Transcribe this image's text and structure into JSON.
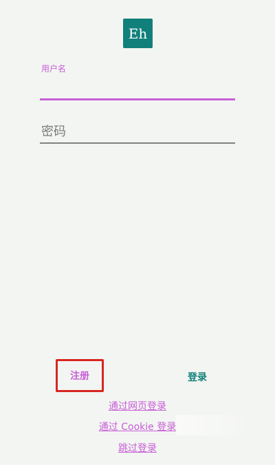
{
  "logo": {
    "text": "Eh",
    "background": "#11807a"
  },
  "username_field": {
    "label": "用户名",
    "value": ""
  },
  "password_field": {
    "placeholder": "密码",
    "value": ""
  },
  "buttons": {
    "register": "注册",
    "login": "登录"
  },
  "links": {
    "web_login": "通过网页登录",
    "cookie_login": "通过 Cookie 登录",
    "skip_login": "跳过登录"
  },
  "colors": {
    "accent": "#c75ed6",
    "teal": "#11807a",
    "highlight_border": "#d7261f",
    "background": "#f3f5f2"
  }
}
